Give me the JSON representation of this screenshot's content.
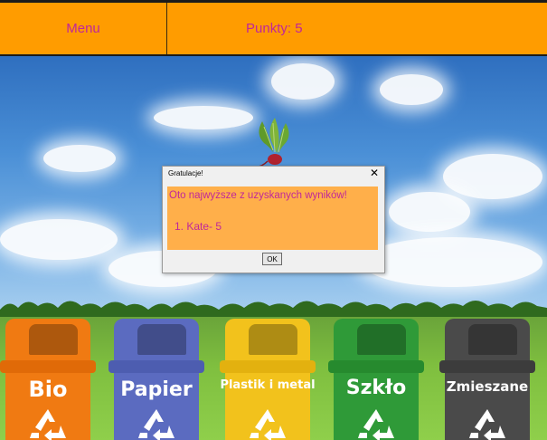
{
  "topbar": {
    "menu_label": "Menu",
    "score_text": "Punkty: 5"
  },
  "dialog": {
    "title": "Gratulacje!",
    "close_glyph": "✕",
    "message": "Oto najwyższe z uzyskanych wyników!",
    "result": "1. Kate- 5",
    "ok_label": "OK"
  },
  "bins": [
    {
      "label": "Bio",
      "color": "#f07a12"
    },
    {
      "label": "Papier",
      "color": "#5b6bc0"
    },
    {
      "label": "Plastik i metal",
      "color": "#f2c21c"
    },
    {
      "label": "Szkło",
      "color": "#2f9a38"
    },
    {
      "label": "Zmieszane",
      "color": "#4a4a4a"
    }
  ],
  "falling_item": {
    "icon": "beet-icon"
  },
  "colors": {
    "topbar": "#ff9c00",
    "text_accent": "#c0279a",
    "dialog_body": "#ffaf4a"
  }
}
